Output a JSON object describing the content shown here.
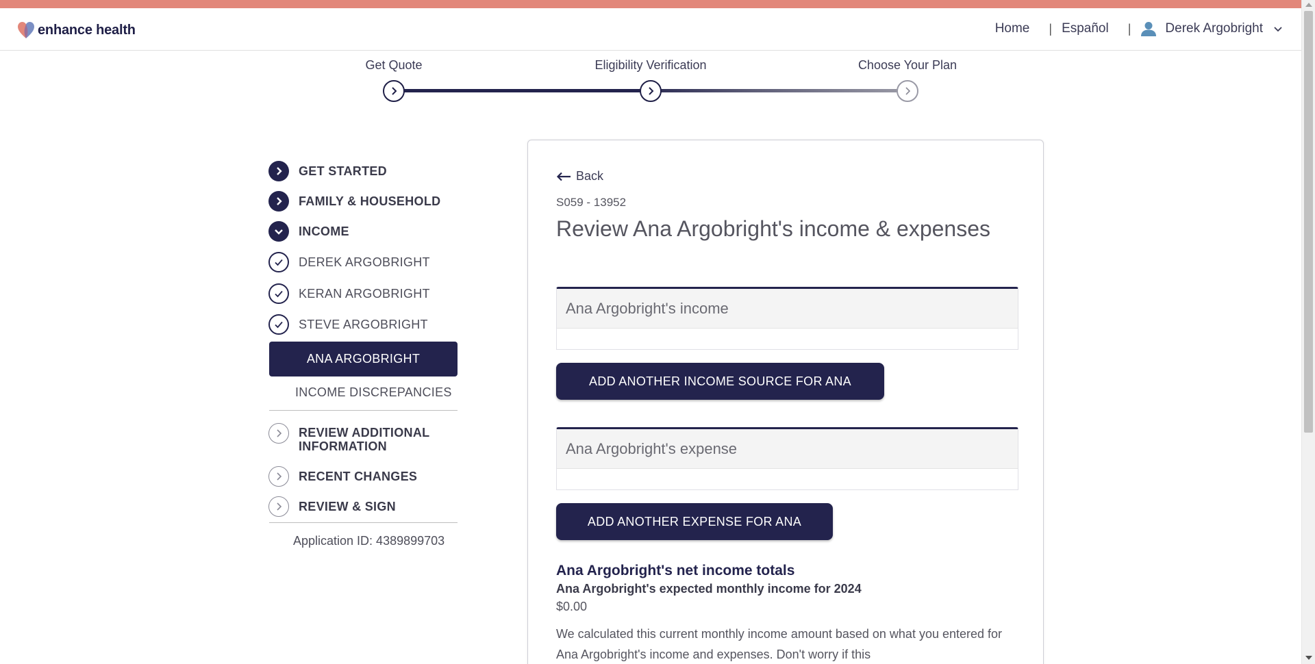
{
  "brand": {
    "name": "enhance health",
    "accent": "#e2877a",
    "primary": "#23234d"
  },
  "nav": {
    "home": "Home",
    "language": "Español",
    "user_name": "Derek Argobright"
  },
  "progress": {
    "steps": [
      {
        "label": "Get Quote",
        "state": "completed"
      },
      {
        "label": "Eligibility Verification",
        "state": "current"
      },
      {
        "label": "Choose Your Plan",
        "state": "upcoming"
      }
    ]
  },
  "sidebar": {
    "items": [
      {
        "label": "GET STARTED"
      },
      {
        "label": "FAMILY & HOUSEHOLD"
      },
      {
        "label": "INCOME"
      },
      {
        "label": "DEREK ARGOBRIGHT"
      },
      {
        "label": "KERAN ARGOBRIGHT"
      },
      {
        "label": "STEVE ARGOBRIGHT"
      },
      {
        "label": "ANA ARGOBRIGHT"
      },
      {
        "label": "INCOME DISCREPANCIES"
      },
      {
        "label": "REVIEW ADDITIONAL INFORMATION"
      },
      {
        "label": "RECENT CHANGES"
      },
      {
        "label": "REVIEW & SIGN"
      }
    ],
    "application_id": "Application ID: 4389899703"
  },
  "main": {
    "back_label": "Back",
    "code": "S059 - 13952",
    "title": "Review Ana Argobright's income & expenses",
    "income_section_title": "Ana Argobright's income",
    "add_income_button": "ADD ANOTHER INCOME SOURCE FOR ANA",
    "expense_section_title": "Ana Argobright's expense",
    "add_expense_button": "ADD ANOTHER EXPENSE FOR ANA",
    "net_title": "Ana Argobright's net income totals",
    "net_subtitle": "Ana Argobright's expected monthly income for 2024",
    "net_amount": "$0.00",
    "net_description": "We calculated this current monthly income amount based on what you entered for Ana Argobright's income and expenses. Don't worry if this"
  }
}
